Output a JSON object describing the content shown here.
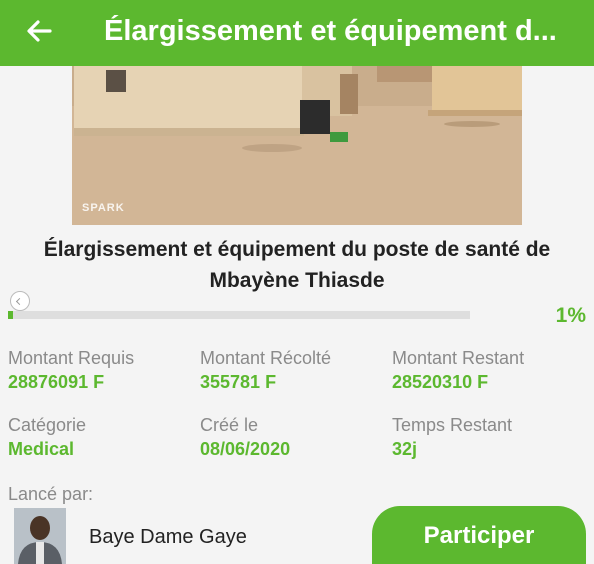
{
  "appbar": {
    "title": "Élargissement et équipement d...",
    "back_icon": "arrow-left-icon",
    "color": "#5cb82f"
  },
  "project": {
    "title": "Élargissement et équipement du poste de santé de Mbayène Thiasde",
    "progress_percent": 1,
    "progress_label": "1%",
    "photo_watermark": "SPARK"
  },
  "stats": {
    "required_label": "Montant Requis",
    "required_value": "28876091 F",
    "collected_label": "Montant Récolté",
    "collected_value": "355781 F",
    "remaining_label": "Montant Restant",
    "remaining_value": "28520310 F",
    "category_label": "Catégorie",
    "category_value": "Medical",
    "created_label": "Créé le",
    "created_value": "08/06/2020",
    "time_left_label": "Temps Restant",
    "time_left_value": "32j"
  },
  "author": {
    "launched_label": "Lancé par:",
    "name": "Baye Dame Gaye"
  },
  "actions": {
    "participate_label": "Participer"
  }
}
